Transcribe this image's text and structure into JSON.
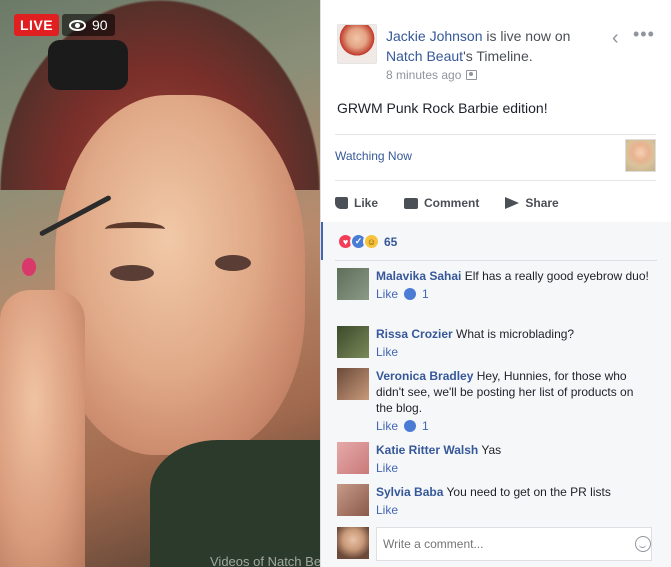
{
  "video": {
    "live_label": "LIVE",
    "viewer_count": "90",
    "watermark": "Videos of Natch Beaut"
  },
  "post": {
    "author": "Jackie Johnson",
    "is_live_text": " is live now on",
    "page_name": "Natch Beaut",
    "timeline_suffix": "'s Timeline.",
    "timestamp": "8 minutes ago",
    "text": "GRWM Punk Rock Barbie edition!",
    "watching_now": "Watching Now"
  },
  "actions": {
    "like": "Like",
    "comment": "Comment",
    "share": "Share"
  },
  "reactions": {
    "count": "65",
    "types": [
      "love",
      "like",
      "haha"
    ]
  },
  "comments": [
    {
      "name": "Malavika Sahai",
      "text": "Elf has a really good eyebrow duo!",
      "like_label": "Like",
      "likes": "1",
      "avatar_color": "#6b7d6a"
    },
    {
      "name": "Rissa Crozier",
      "text": "What is microblading?",
      "like_label": "Like",
      "likes": "",
      "avatar_color": "#4a5a34"
    },
    {
      "name": "Veronica Bradley",
      "text": "Hey, Hunnies, for those who didn't see, we'll be posting her list of products on the blog.",
      "like_label": "Like",
      "likes": "1",
      "avatar_color": "#8a6a5a"
    },
    {
      "name": "Katie Ritter Walsh",
      "text": "Yas",
      "like_label": "Like",
      "likes": "",
      "avatar_color": "#d89a9a"
    },
    {
      "name": "Sylvia Baba",
      "text": "You need to get on the PR lists",
      "like_label": "Like",
      "likes": "",
      "avatar_color": "#b5867a"
    }
  ],
  "composer": {
    "placeholder": "Write a comment..."
  },
  "icons": {
    "viewers": "eye-icon",
    "privacy": "friends-icon",
    "collapse": "chevron-left-icon",
    "more": "more-icon",
    "emoji": "smiley-icon"
  }
}
